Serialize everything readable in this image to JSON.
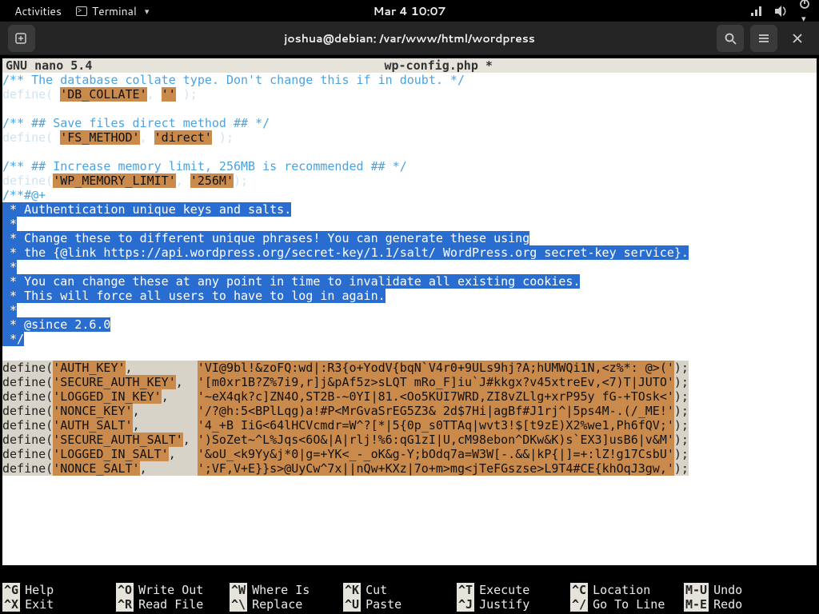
{
  "panel": {
    "activities": "Activities",
    "appmenu": "Terminal",
    "clock": "Mar 4  10:07"
  },
  "titlebar": {
    "title": "joshua@debian: /var/www/html/wordpress"
  },
  "nano": {
    "app": "  GNU nano 5.4",
    "filename": "wp-config.php *"
  },
  "code": {
    "l01": "/** The database collate type. Don't change this if in doubt. */",
    "l02a": "define( ",
    "l02b": "'DB_COLLATE'",
    "l02c": ", ",
    "l02d": "''",
    "l02e": " );",
    "l03": "",
    "l04": "/** ## Save files direct method ## */",
    "l05a": "define( ",
    "l05b": "'FS_METHOD'",
    "l05c": ", ",
    "l05d": "'direct'",
    "l05e": " );",
    "l06": "",
    "l07": "/** ## Increase memory limit, 256MB is recommended ## */",
    "l08a": "define(",
    "l08b": "'WP_MEMORY_LIMIT'",
    "l08c": ", ",
    "l08d": "'256M'",
    "l08e": ");",
    "l09": "/**#@+",
    "l10": " * Authentication unique keys and salts.",
    "l11": " *",
    "l12": " * Change these to different unique phrases! You can generate these using",
    "l13": " * the {@link https://api.wordpress.org/secret-key/1.1/salt/ WordPress.org secret-key service}.",
    "l14": " *",
    "l15": " * You can change these at any point in time to invalidate all existing cookies.",
    "l16": " * This will force all users to have to log in again.",
    "l17": " *",
    "l18": " * @since 2.6.0",
    "l19": " */",
    "k1n": "'AUTH_KEY'",
    "k1v": "'VI@9bl!&zoFQ:wd|:R3{o+YodV{bqN`V4r0+9ULs9hj?A;hUMWQi1N,<z%*: @>('",
    "k2n": "'SECURE_AUTH_KEY'",
    "k2v": "'[m0xr1B?Z%7i9,r]j&pAf5z>sLQT mRo_F]iu`J#kkgx?v45xtreEv,<7)T|JUTO'",
    "k3n": "'LOGGED_IN_KEY'",
    "k3v": "'~eX4qk?c]ZN4O,ST2B-~0YI|81.<Oo5KUI7WRD,ZI8vZLlg+xrP95y fG-+TOsk<'",
    "k4n": "'NONCE_KEY'",
    "k4v": "'/?@h:5<BPlLqg)a!#P<MrGvaSrEG5Z3& 2d$7Hi|agBf#J1rj^|5ps4M-.(/_ME!'",
    "k5n": "'AUTH_SALT'",
    "k5v": "'4_+B IiG<64lHCVcmdr=W^?[*|5{0p_s0TTAq|wvt3!$[t9zE)X2%we1,Ph6fQV;'",
    "k6n": "'SECURE_AUTH_SALT'",
    "k6v": "')SoZet~^L%Jqs<6O&|A|rlj!%6:qG1zI|U,cM98ebon^DKw&K)s`EX3]usB6|v&M'",
    "k7n": "'LOGGED_IN_SALT'",
    "k7v": "'&oU_<k9Yy&j*0|g=+YK<_-_oK&g-Y;bOdq7a=W3W[-.&&|kP{|]=+:lZ!g17CsbU'",
    "k8n": "'NONCE_SALT'",
    "k8v": "';VF,V+E}}s>@UyCw^7x||nQw+KXz|7o+m>mg<jTeFGszse>L9T4#CE{khOqJ3gw,'",
    "defp": "define(",
    "defc": ",",
    "defs": "         ",
    "defend": ");",
    "sp1": ",         ",
    "sp2": ", ",
    "sp3": ",  ",
    "sp4": ",    ",
    "sp5": ",       ",
    "sp6": ",        ",
    "sp7": ",   "
  },
  "help": {
    "r1": [
      [
        "^G",
        "Help"
      ],
      [
        "^O",
        "Write Out"
      ],
      [
        "^W",
        "Where Is"
      ],
      [
        "^K",
        "Cut"
      ],
      [
        "^T",
        "Execute"
      ],
      [
        "^C",
        "Location"
      ],
      [
        "M-U",
        "Undo"
      ]
    ],
    "r2": [
      [
        "^X",
        "Exit"
      ],
      [
        "^R",
        "Read File"
      ],
      [
        "^\\",
        "Replace"
      ],
      [
        "^U",
        "Paste"
      ],
      [
        "^J",
        "Justify"
      ],
      [
        "^/",
        "Go To Line"
      ],
      [
        "M-E",
        "Redo"
      ]
    ]
  }
}
